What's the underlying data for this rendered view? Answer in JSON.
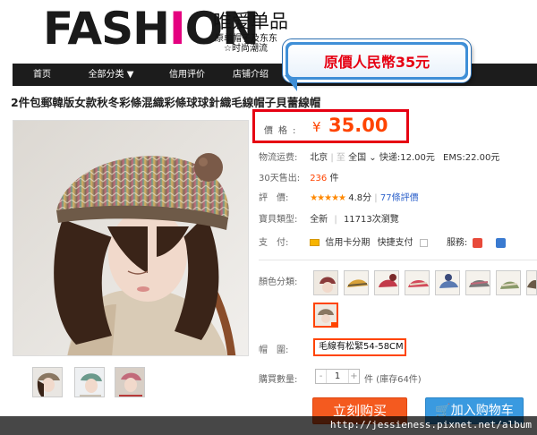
{
  "header": {
    "logo_pre": "FASH",
    "logo_i": "I",
    "logo_post": "ON",
    "logo_cn": "唯爱单品",
    "logo_sub1": "原单帽子及东东",
    "logo_sub2": "☆时尚潮流"
  },
  "callout": {
    "text": "原價人民幣35元"
  },
  "nav": {
    "home": "首页",
    "categories": "全部分类 ▼",
    "credit": "信用评价",
    "shop_intro": "店铺介绍"
  },
  "product": {
    "title": "2件包郵韓版女款秋冬彩條混織彩條球球針織毛線帽子貝蕾線帽"
  },
  "price": {
    "label": "價格:",
    "currency": "¥",
    "value": "35.00"
  },
  "shipping": {
    "label": "物流运费:",
    "from": "北京",
    "to": "全国",
    "express": "快递:12.00元",
    "ems": "EMS:22.00元"
  },
  "sales": {
    "label": "30天售出:",
    "count": "236",
    "unit": "件"
  },
  "rating": {
    "label": "評　價:",
    "stars": "★★★★★",
    "score": "4.8分",
    "reviews": "77條評價"
  },
  "goods_type": {
    "label": "寶貝類型:",
    "value": "全新",
    "sep": "|",
    "extra": "11713次瀏覽"
  },
  "payment": {
    "label": "支　付:",
    "card": "信用卡分期",
    "fast": "快捷支付",
    "service": "服務:"
  },
  "color": {
    "label": "顏色分類:"
  },
  "size": {
    "label": "帽　圍:",
    "option": "毛線有松緊54-58CM"
  },
  "quantity": {
    "label": "購買數量:",
    "value": "1",
    "stock": "件 (庫存64件)"
  },
  "buttons": {
    "buy_now": "立刻购买",
    "add_to_cart": "加入购物车"
  },
  "watermark": {
    "text": "http://jessieness.pixnet.net/album"
  },
  "colors": {
    "price": "#ff4400",
    "callout_text": "#e60012",
    "buy": "#f45a1f",
    "cart": "#3a9ae0",
    "nav": "#1c1c1c"
  }
}
